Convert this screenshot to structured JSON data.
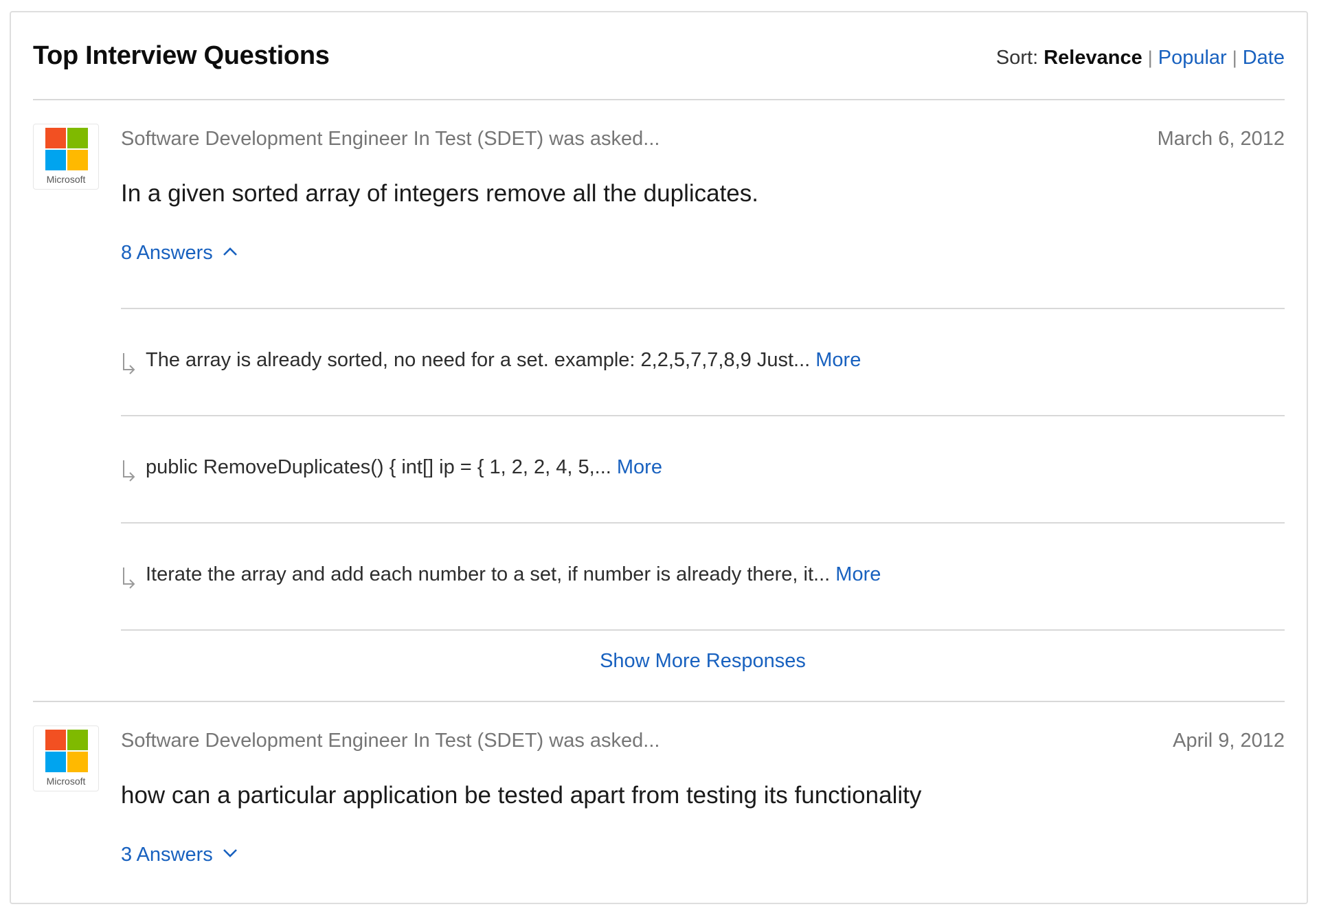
{
  "header": {
    "title": "Top Interview Questions",
    "sort_label": "Sort:",
    "sort_options": [
      "Relevance",
      "Popular",
      "Date"
    ],
    "sort_separator": "|"
  },
  "questions": [
    {
      "company_logo_text": "Microsoft",
      "role_asked": "Software Development Engineer In Test (SDET) was asked...",
      "date": "March 6, 2012",
      "question": "In a given sorted array of integers remove all the duplicates.",
      "answers_label": "8 Answers",
      "answers_expanded": true,
      "answers": [
        {
          "text": "The array is already sorted, no need for a set. example: 2,2,5,7,7,8,9 Just...",
          "more": "More"
        },
        {
          "text": "public RemoveDuplicates() { int[] ip = { 1, 2, 2, 4, 5,...",
          "more": "More"
        },
        {
          "text": "Iterate the array and add each number to a set, if number is already there, it...",
          "more": "More"
        }
      ],
      "show_more_label": "Show More Responses"
    },
    {
      "company_logo_text": "Microsoft",
      "role_asked": "Software Development Engineer In Test (SDET) was asked...",
      "date": "April 9, 2012",
      "question": "how can a particular application be tested apart from testing its functionality",
      "answers_label": "3 Answers",
      "answers_expanded": false
    }
  ],
  "colors": {
    "link": "#1861bf",
    "ms_red": "#f25022",
    "ms_green": "#7fba00",
    "ms_blue": "#00a4ef",
    "ms_yellow": "#ffb900"
  },
  "icons": {
    "expanded_toggle": "chevron-up-icon",
    "collapsed_toggle": "chevron-down-icon",
    "answer_marker": "reply-arrow-icon"
  }
}
